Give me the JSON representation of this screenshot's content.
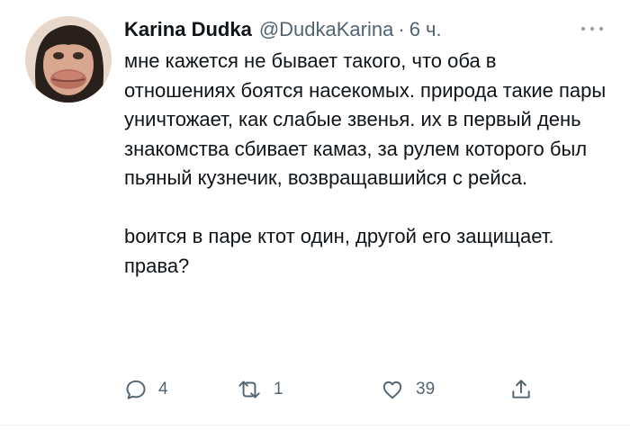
{
  "tweet": {
    "author": {
      "name": "Karina Dudka",
      "handle": "@DudkaKarina",
      "separator": "·",
      "time": "6 ч.",
      "avatar_icon": "avatar-photo"
    },
    "text": "мне кажется не бывает такого, что оба в отношениях боятся насекомых. природа такие пары уничтожает, как слабые звенья. их в первый день знакомства сбивает камаз, за рулем которого был пьяный кузнечик, возвращавшийся с рейса.\n\nboится в паре ктот один, другой его защищает. права?",
    "actions": {
      "reply": {
        "icon": "reply-icon",
        "count": "4"
      },
      "retweet": {
        "icon": "retweet-icon",
        "count": "1"
      },
      "like": {
        "icon": "heart-icon",
        "count": "39"
      },
      "share": {
        "icon": "share-icon"
      }
    },
    "more_icon": "more-icon"
  },
  "colors": {
    "primary_text": "#0f1419",
    "secondary_text": "#536471",
    "divider": "#eff3f4"
  }
}
